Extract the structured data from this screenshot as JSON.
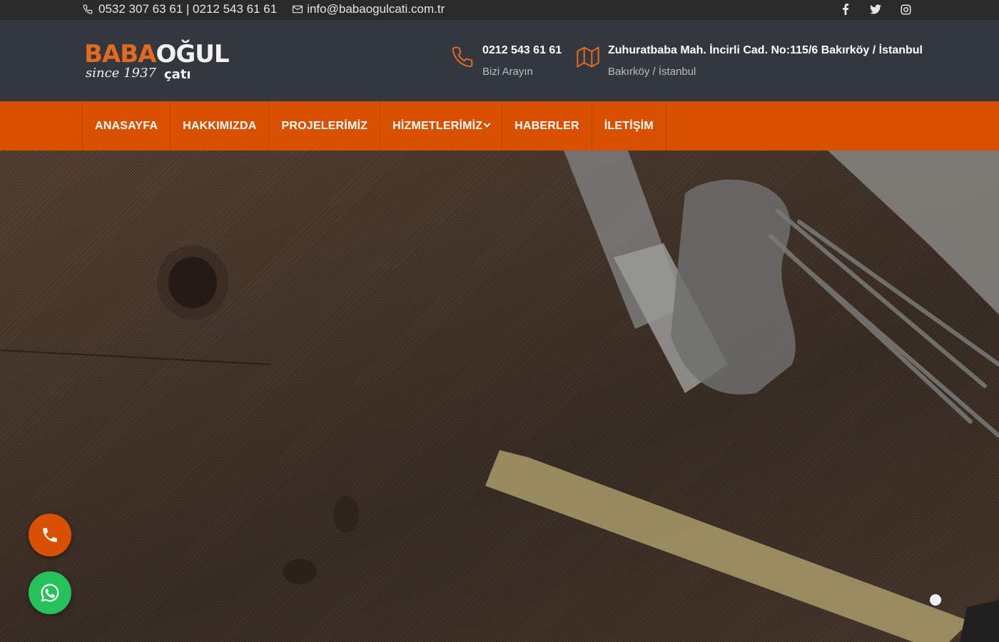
{
  "topbar": {
    "phones": "0532 307 63 61 | 0212 543 61 61",
    "email": "info@babaogulcati.com.tr",
    "social": [
      "facebook-icon",
      "twitter-icon",
      "instagram-icon"
    ]
  },
  "logo": {
    "part1": "BABA",
    "part2": "OĞUL",
    "since": "since 1937",
    "sub": "çatı"
  },
  "header": {
    "phone_title": "0212 543 61 61",
    "phone_sub": "Bizi Arayın",
    "address_title": "Zuhuratbaba Mah. İncirli Cad. No:115/6 Bakırköy / İstanbul",
    "address_sub": "Bakırköy / İstanbul"
  },
  "nav": {
    "items": [
      {
        "label": "ANASAYFA"
      },
      {
        "label": "HAKKIMIZDA"
      },
      {
        "label": "PROJELERİMİZ"
      },
      {
        "label": "HİZMETLERİMİZ"
      },
      {
        "label": "HABERLER"
      },
      {
        "label": "İLETİŞİM"
      }
    ]
  },
  "colors": {
    "accent": "#d95100",
    "header_bg": "#33383e",
    "topbar_bg": "#2a2a2a",
    "whatsapp": "#25c25a"
  },
  "fabs": {
    "call": "phone-icon",
    "whatsapp": "whatsapp-icon"
  }
}
